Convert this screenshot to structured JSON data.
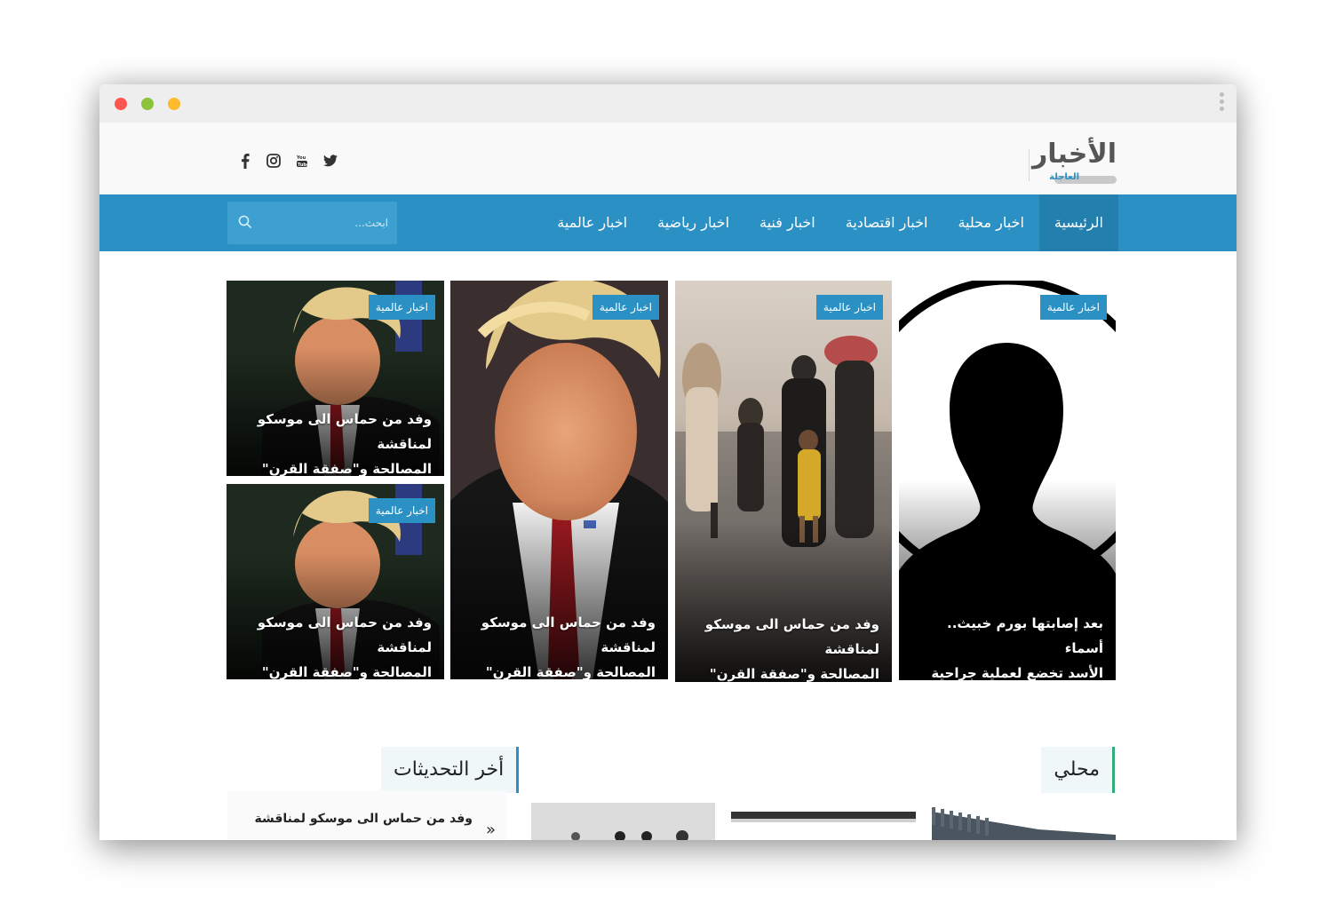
{
  "logo": {
    "main": "الأخبار",
    "sub": "العاجلة"
  },
  "social": [
    "facebook-icon",
    "instagram-icon",
    "youtube-icon",
    "twitter-icon"
  ],
  "nav": {
    "items": [
      {
        "label": "الرئيسية"
      },
      {
        "label": "اخبار محلية"
      },
      {
        "label": "اخبار اقتصادية"
      },
      {
        "label": "اخبار فنية"
      },
      {
        "label": "اخبار رياضية"
      },
      {
        "label": "اخبار عالمية"
      }
    ]
  },
  "search": {
    "placeholder": "ابحث..."
  },
  "cards": [
    {
      "badge": "اخبار عالمية",
      "line1": "بعد إصابتها بورم خبيث.. أسماء",
      "line2": "الأسد تخضع لعملية جراحية"
    },
    {
      "badge": "اخبار عالمية",
      "line1": "وفد من حماس الى موسكو لمناقشة",
      "line2": "المصالحة و\"صفقة القرن\""
    },
    {
      "badge": "اخبار عالمية",
      "line1": "وفد من حماس الى موسكو لمناقشة",
      "line2": "المصالحة و\"صفقة القرن\""
    },
    {
      "badge": "اخبار عالمية",
      "line1": "وفد من حماس الى موسكو لمناقشة",
      "line2": "المصالحة و\"صفقة القرن\""
    },
    {
      "badge": "اخبار عالمية",
      "line1": "وفد من حماس الى موسكو لمناقشة",
      "line2": "المصالحة و\"صفقة القرن\""
    }
  ],
  "sections": {
    "local": "محلي",
    "latest": "أخر التحديثات"
  },
  "latest": {
    "item": "وفد من حماس الى موسكو لمناقشة",
    "arrow": "»"
  },
  "colors": {
    "brand": "#2b91c4",
    "nav_active": "#237fae",
    "local_accent": "#2fae7a"
  }
}
